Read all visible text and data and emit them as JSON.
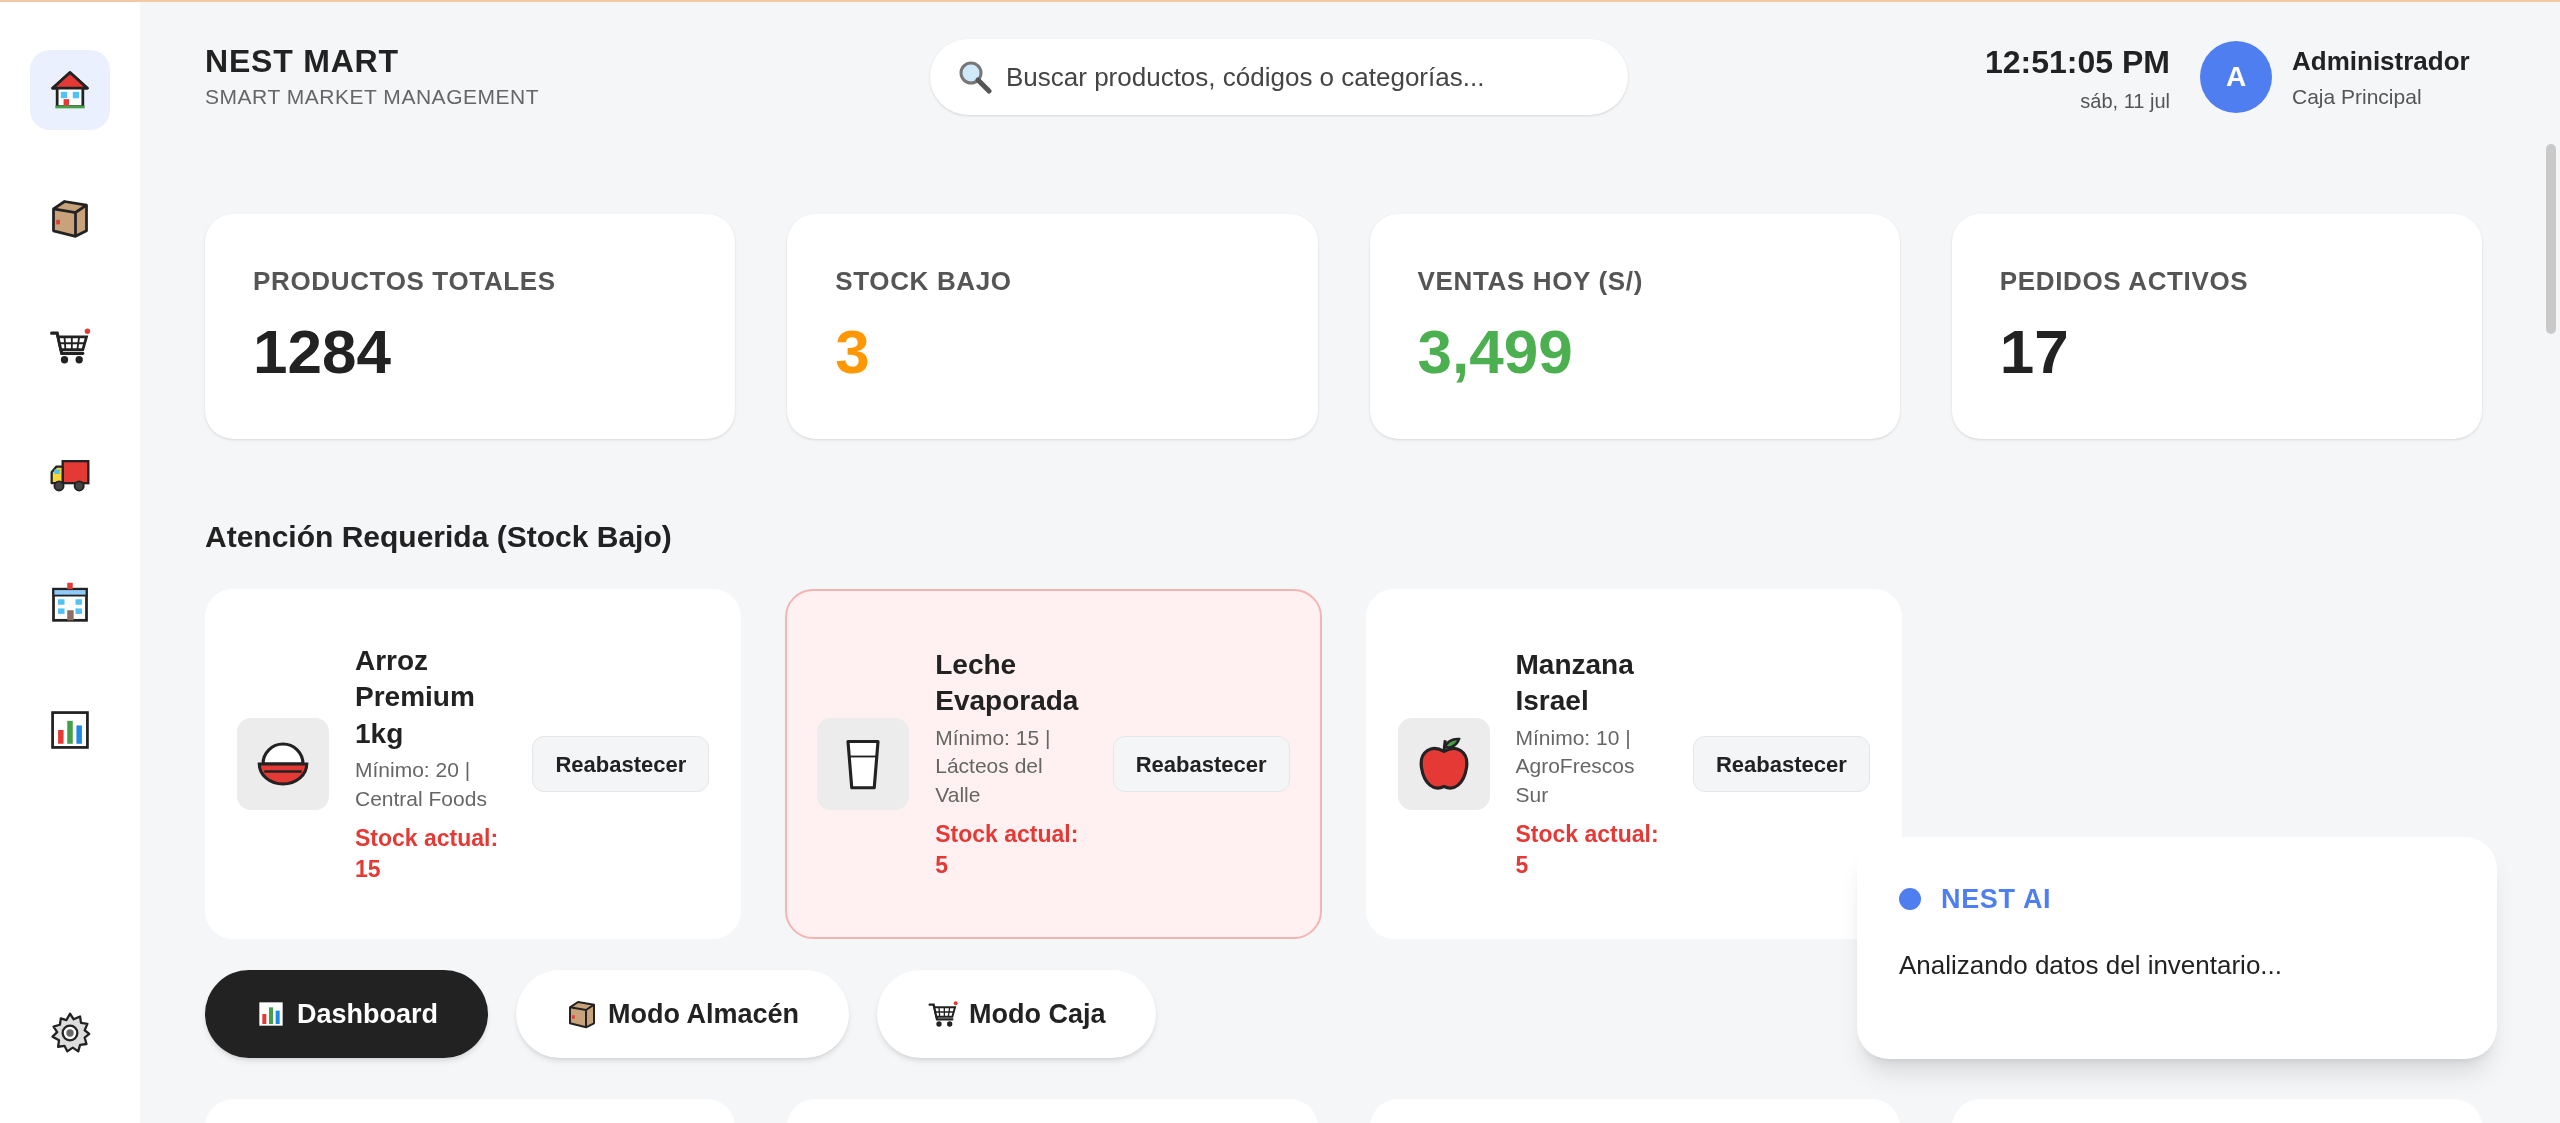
{
  "sidebar": {
    "items": [
      {
        "kind": "home",
        "selected": true
      },
      {
        "kind": "box",
        "selected": false
      },
      {
        "kind": "cart",
        "selected": false
      },
      {
        "kind": "truck",
        "selected": false
      },
      {
        "kind": "store",
        "selected": false
      },
      {
        "kind": "chart",
        "selected": false
      }
    ],
    "settings": {
      "kind": "gear"
    }
  },
  "header": {
    "brand": "NEST MART",
    "tagline": "SMART MARKET MANAGEMENT",
    "search": {
      "placeholder": "Buscar productos, códigos o categorías..."
    },
    "time": "12:51:05 PM",
    "date": "sáb, 11 jul",
    "user": {
      "initial": "A",
      "name": "Administrador",
      "role": "Caja Principal"
    }
  },
  "stats": [
    {
      "label": "PRODUCTOS TOTALES",
      "value": "1284",
      "color": "#222222"
    },
    {
      "label": "STOCK BAJO",
      "value": "3",
      "color": "#ff9800"
    },
    {
      "label": "VENTAS HOY (S/)",
      "value": "3,499",
      "color": "#4caf50"
    },
    {
      "label": "PEDIDOS ACTIVOS",
      "value": "17",
      "color": "#222222"
    }
  ],
  "low_stock": {
    "title": "Atención Requerida (Stock Bajo)",
    "items": [
      {
        "kind": "rice",
        "name": "Arroz Premium 1kg",
        "detail": "Mínimo: 20 | Central Foods",
        "stock": "Stock actual: 15",
        "button": "Reabastecer",
        "selected": false
      },
      {
        "kind": "milk",
        "name": "Leche Evaporada",
        "detail": "Mínimo: 15 | Lácteos del Valle",
        "stock": "Stock actual: 5",
        "button": "Reabastecer",
        "selected": true
      },
      {
        "kind": "apple",
        "name": "Manzana Israel",
        "detail": "Mínimo: 10 | AgroFrescos Sur",
        "stock": "Stock actual: 5",
        "button": "Reabastecer",
        "selected": false
      }
    ]
  },
  "modes": [
    {
      "kind": "chart",
      "label": "Dashboard",
      "selected": true
    },
    {
      "kind": "box",
      "label": "Modo Almacén",
      "selected": false
    },
    {
      "kind": "cart",
      "label": "Modo Caja",
      "selected": false
    }
  ],
  "assistant": {
    "title": "NEST AI",
    "message": "Analizando datos del inventario..."
  }
}
